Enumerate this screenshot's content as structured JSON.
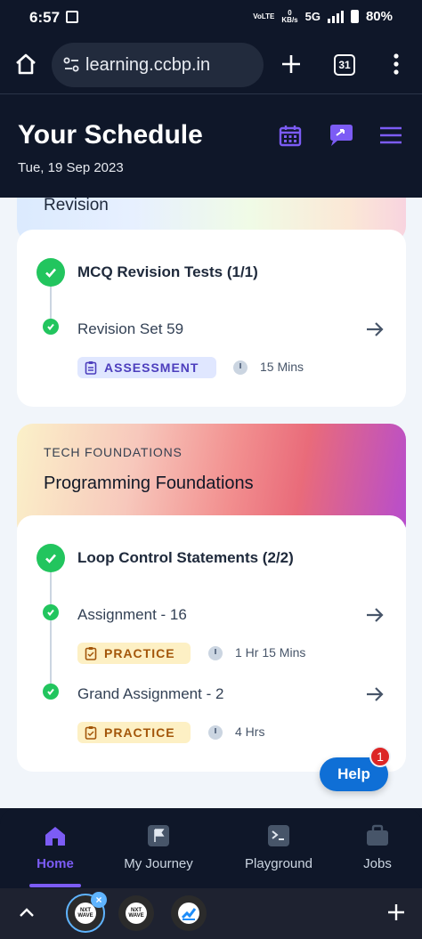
{
  "status_bar": {
    "time": "6:57",
    "network_top": "VoLTE",
    "data_rate": "0",
    "data_unit": "KB/s",
    "network": "5G",
    "battery": "80%"
  },
  "browser": {
    "url": "learning.ccbp.in",
    "tab_count": "31"
  },
  "header": {
    "title": "Your Schedule",
    "date": "Tue, 19 Sep 2023"
  },
  "sections": [
    {
      "title": "Revision",
      "topics": [
        {
          "title": "MCQ Revision Tests (1/1)",
          "items": [
            {
              "title": "Revision Set 59",
              "tag": "ASSESSMENT",
              "duration": "15 Mins"
            }
          ]
        }
      ]
    },
    {
      "kicker": "TECH FOUNDATIONS",
      "title": "Programming Foundations",
      "topics": [
        {
          "title": "Loop Control Statements (2/2)",
          "items": [
            {
              "title": "Assignment - 16",
              "tag": "PRACTICE",
              "duration": "1 Hr 15 Mins"
            },
            {
              "title": "Grand Assignment - 2",
              "tag": "PRACTICE",
              "duration": "4 Hrs"
            }
          ]
        }
      ]
    }
  ],
  "help": {
    "label": "Help",
    "badge": "1"
  },
  "bottom_nav": [
    {
      "label": "Home",
      "icon": "home-icon",
      "active": true
    },
    {
      "label": "My Journey",
      "icon": "flag-icon",
      "active": false
    },
    {
      "label": "Playground",
      "icon": "terminal-icon",
      "active": false
    },
    {
      "label": "Jobs",
      "icon": "briefcase-icon",
      "active": false
    }
  ],
  "bubbles": [
    {
      "label": "NXT WAVE"
    },
    {
      "label": "NXT WAVE"
    },
    {
      "label": ""
    }
  ],
  "colors": {
    "accent": "#7c5cf5",
    "success": "#22c55e",
    "help": "#0f6fd6",
    "dark": "#0f1729"
  }
}
